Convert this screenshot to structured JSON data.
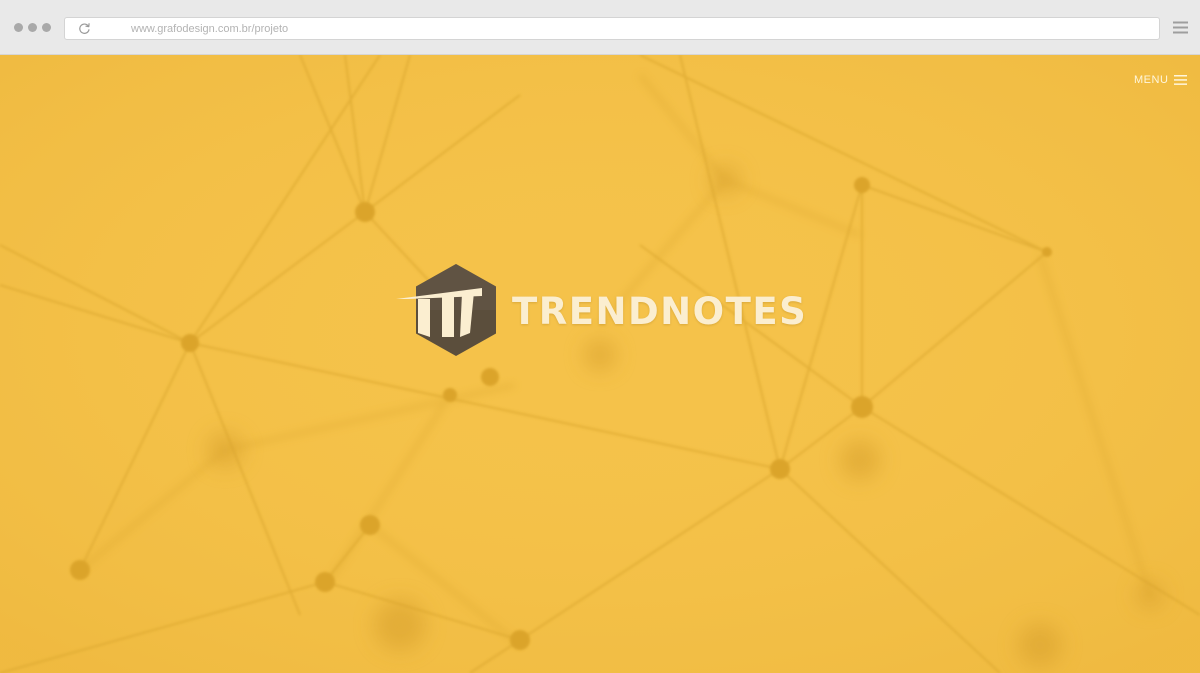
{
  "browser": {
    "address_bar": {
      "url": "www.grafodesign.com.br/projeto"
    },
    "icons": {
      "reload": "reload-icon",
      "menu": "hamburger-menu-icon"
    }
  },
  "site": {
    "menu_label": "MENU",
    "brand_name": "TRENDNOTES",
    "logo_icon": "trendnotes-hexagon-logo"
  },
  "colors": {
    "hero_background": "#f5c24a",
    "logo_hexagon": "#5b4e3c",
    "brand_text": "#fbeed0",
    "chrome": "#e9e9e9"
  }
}
